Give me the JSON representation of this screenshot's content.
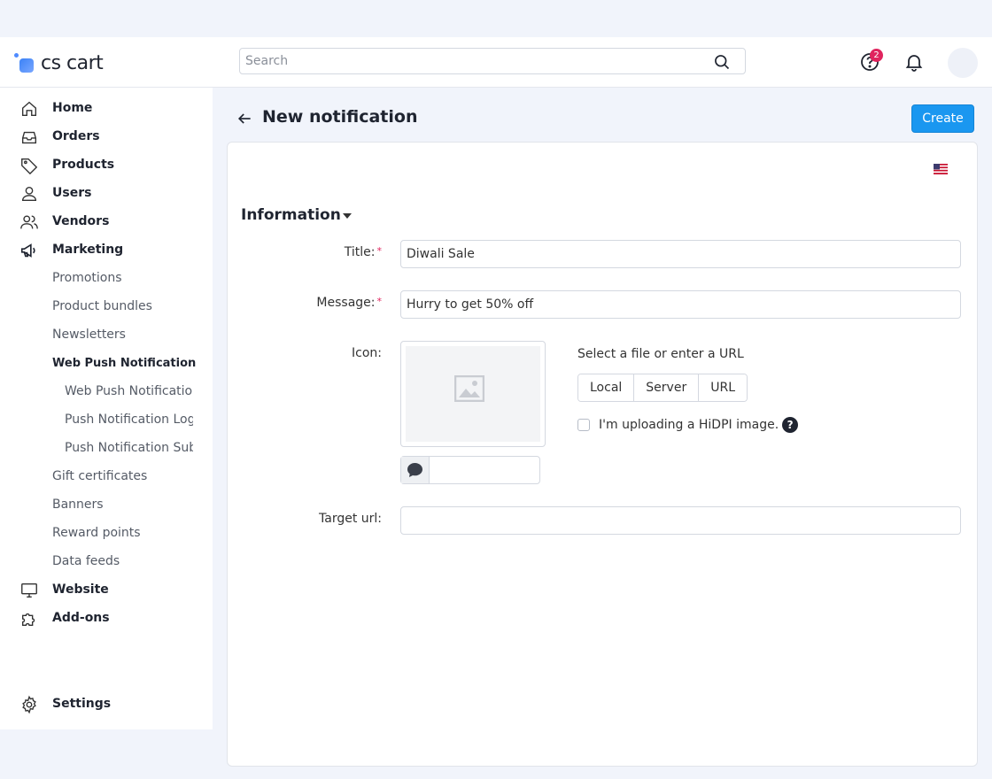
{
  "header": {
    "logo_text": "cs cart",
    "search_placeholder": "Search",
    "help_badge_count": "2"
  },
  "sidebar": {
    "items": [
      {
        "label": "Home",
        "icon": "home-icon"
      },
      {
        "label": "Orders",
        "icon": "inbox-icon"
      },
      {
        "label": "Products",
        "icon": "tag-icon"
      },
      {
        "label": "Users",
        "icon": "user-icon"
      },
      {
        "label": "Vendors",
        "icon": "users-icon"
      },
      {
        "label": "Marketing",
        "icon": "megaphone-icon"
      }
    ],
    "marketing_sub": [
      "Promotions",
      "Product bundles",
      "Newsletters",
      "Web Push Notification"
    ],
    "web_push_sub": [
      "Web Push Notification",
      "Push Notification Log",
      "Push Notification Subscribers"
    ],
    "marketing_sub_after": [
      "Gift certificates",
      "Banners",
      "Reward points",
      "Data feeds"
    ],
    "bottom_items": [
      {
        "label": "Website",
        "icon": "monitor-icon"
      },
      {
        "label": "Add-ons",
        "icon": "puzzle-icon"
      }
    ],
    "settings_label": "Settings"
  },
  "page": {
    "title": "New notification",
    "create_label": "Create"
  },
  "form": {
    "section_title": "Information",
    "title_label": "Title:",
    "title_value": "Diwali Sale",
    "message_label": "Message:",
    "message_value": "Hurry to get 50% off",
    "icon_label": "Icon:",
    "select_file_text": "Select a file or enter a URL",
    "source_options": [
      "Local",
      "Server",
      "URL"
    ],
    "hidpi_label": "I'm uploading a HiDPI image.",
    "help_mark": "?",
    "target_url_label": "Target url:",
    "target_url_value": ""
  },
  "colors": {
    "accent": "#1a97f0",
    "required": "#e0245e",
    "badge": "#e0245e"
  }
}
